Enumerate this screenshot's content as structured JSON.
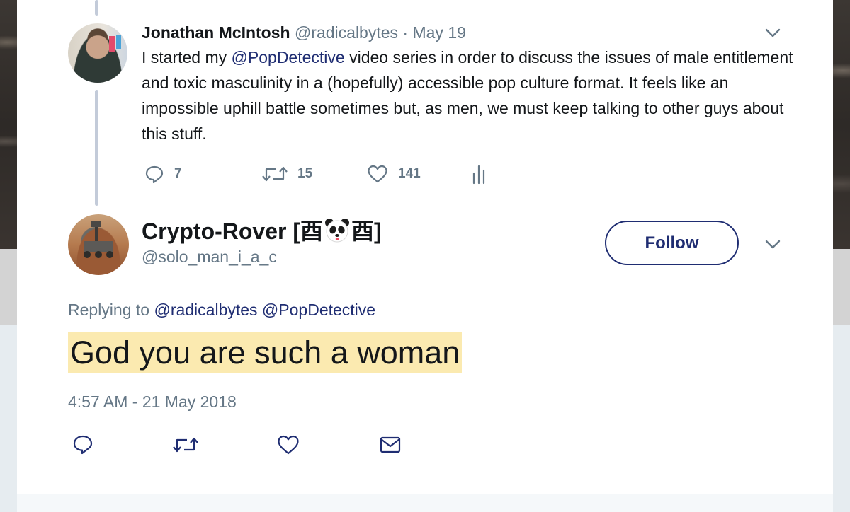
{
  "parent_tweet": {
    "author_name": "Jonathan McIntosh",
    "author_handle": "@radicalbytes",
    "separator": " · ",
    "date": "May 19",
    "text_before": "I started my ",
    "mention": "@PopDetective",
    "text_after": " video series in order to discuss the issues of male entitlement and toxic masculinity in a (hopefully) accessible pop culture format. It feels like an impossible uphill battle sometimes but, as men, we must keep talking to other guys about this stuff.",
    "reply_count": "7",
    "retweet_count": "15",
    "like_count": "141"
  },
  "reply_tweet": {
    "author_name_before": "Crypto-Rover [酉",
    "author_name_after": "酉]",
    "author_handle": "@solo_man_i_a_c",
    "follow_label": "Follow",
    "replying_label": "Replying to ",
    "replying_handles": "@radicalbytes @PopDetective",
    "text": "God you are such a woman",
    "timestamp": "4:57 AM - 21 May 2018"
  },
  "icons": {
    "reply": "reply-icon",
    "retweet": "retweet-icon",
    "like": "heart-icon",
    "analytics": "analytics-icon",
    "dm": "envelope-icon",
    "caret": "chevron-down-icon",
    "emoji": "panda-face-icon"
  },
  "colors": {
    "link": "#1f2d72",
    "muted": "#657786",
    "highlight": "#fbeab0",
    "thread_line": "#c3cbd9"
  }
}
